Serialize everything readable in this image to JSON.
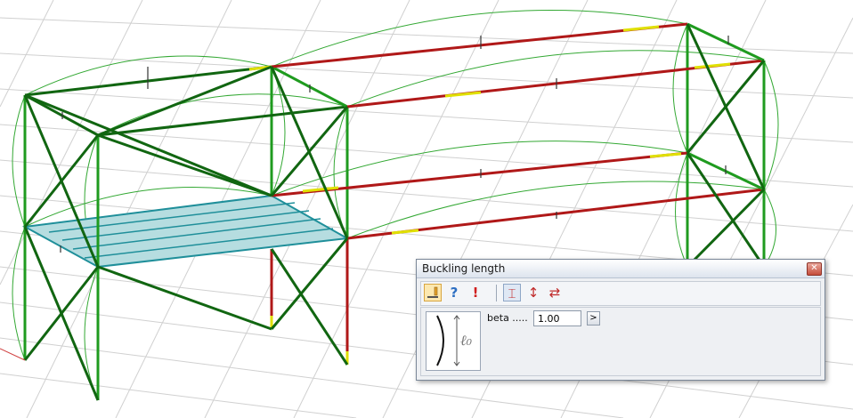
{
  "viewport": {
    "colors": {
      "grid": "#c8c8c8",
      "member_green": "#1f9b1f",
      "member_dark": "#116611",
      "member_red": "#b01818",
      "member_yellow": "#e0e000",
      "slab": "#1f8f9a",
      "curve": "#33a833"
    }
  },
  "dialog": {
    "title": "Buckling length",
    "close_glyph": "✕",
    "toolbar": {
      "edit_icon": "pencil-edit-icon",
      "help_glyph": "?",
      "warning_glyph": "!",
      "mode_y_glyph": "⌶",
      "mode_z_glyph": "↕",
      "mode_lt_glyph": "⇄"
    },
    "beta_label": "beta .....",
    "beta_value": "1.00",
    "more_glyph": ">",
    "diagram_symbol": "ℓ₀"
  }
}
